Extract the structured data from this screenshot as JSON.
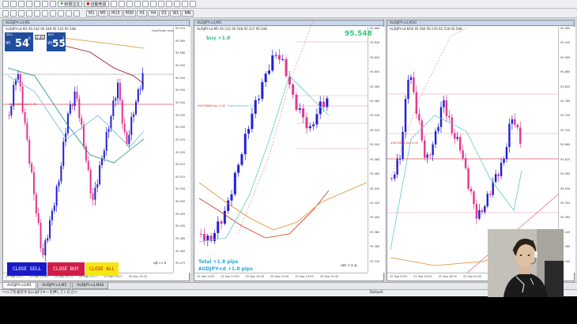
{
  "toolbar": {
    "new_order_label": "新規注文",
    "autotrade_label": "自動売買",
    "timeframes": [
      "M1",
      "M5",
      "M15",
      "M30",
      "H1",
      "H4",
      "D1",
      "W1",
      "MN"
    ]
  },
  "charts": [
    {
      "title": "AUDJPY-cd,M1",
      "info": "AUDJPY-cd,M1  95.542 95.548 95.516 95.548",
      "trade_line_label": "#4030808 buy 0.40",
      "right_label": "Line/Order Level",
      "prices": [
        "95.570",
        "95.565",
        "95.560",
        "95.555",
        "95.550",
        "95.545",
        "95.540",
        "95.535",
        "95.530",
        "95.525",
        "95.520",
        "95.515",
        "95.510",
        "95.505",
        "95.500",
        "95.495",
        "95.490",
        "95.485",
        "95.480",
        "95.475"
      ],
      "times": [
        "25 Sep 2023",
        "25 Sep 15:09",
        "25 Sep 15:13",
        "25 Sep 15:17",
        "25 Sep 15:21",
        "25 Sep 15:25"
      ],
      "corner_text": "4枠 1 0 N"
    },
    {
      "title": "AUDJPY-cd,M5",
      "info": "AUDJPY-cd,M5  95.532 95.548 95.527 95.548",
      "trade_line_label": "#4030808 buy 0.40",
      "trade_line_label2": "Good business: 0.0",
      "prices": [
        "95.660",
        "95.640",
        "95.620",
        "95.600",
        "95.580",
        "95.560",
        "95.540",
        "95.520",
        "95.500",
        "95.480",
        "95.460",
        "95.440",
        "95.420",
        "95.400",
        "95.380",
        "95.360",
        "95.340"
      ],
      "times": [
        "25 Sep 2023",
        "25 Sep 13:00",
        "25 Sep 13:40",
        "25 Sep 14:20",
        "25 Sep 15:00",
        "25 Sep 15:40"
      ],
      "corner_text": "4枠1 3 中 北"
    },
    {
      "title": "AUDJPY-cd,M30",
      "info": "AUDJPY-cd,M30  95.560 95.576 95.518 95.548",
      "trade_line_label": "#4030808 buy 0.40",
      "prices": [
        "95.980",
        "95.940",
        "95.900",
        "95.860",
        "95.820",
        "95.780",
        "95.740",
        "95.700",
        "95.660",
        "95.620",
        "95.580",
        "95.540",
        "95.500",
        "95.460",
        "95.420",
        "95.380",
        "95.340"
      ],
      "times": [
        "20 Sep 2023",
        "21 Sep 10:00",
        "21 Sep 18:00",
        "22 Sep 02:00",
        "22 Sep 10:00",
        "25 Sep 02:00"
      ]
    }
  ],
  "trade_panel": {
    "sell_label": "SELL",
    "buy_label": "BUY",
    "lot": "0.40",
    "bid_big": "54",
    "bid_prefix": "95",
    "bid_sup": "8",
    "ask_big": "55",
    "ask_prefix": "95",
    "ask_sup": "2"
  },
  "buttons": {
    "close_sell": "CLOSE SELL",
    "close_buy": "CLOSE BUY",
    "close_all": "CLOSE ALL"
  },
  "overlays": {
    "buy_label": "buy +1.8",
    "price_big": "95.548",
    "total": "Total +1.8 pips",
    "pair_total": "AUDJPY-cd +1.8 pips"
  },
  "tabs": [
    "AUDJPY-cd,M1",
    "AUDJPY-cd,M5",
    "AUDJPY-cd,M30"
  ],
  "status": {
    "help": "ヘルプを表示するにはF1キーを押してください",
    "profile": "Default"
  },
  "colors": {
    "bull_candle": "#2320d6",
    "bear_candle": "#e2378e",
    "close_sell_bg": "#1919c9",
    "close_buy_bg": "#d11c48",
    "close_all_bg": "#f3e812"
  }
}
